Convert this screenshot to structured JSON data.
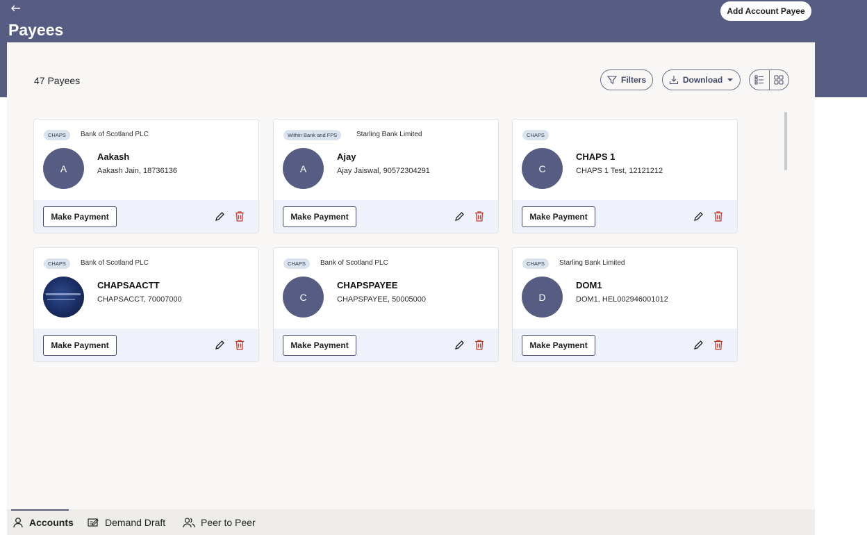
{
  "header": {
    "back_icon": "arrow-left-icon",
    "title": "Payees",
    "add_button_label": "Add Account Payee",
    "band_color": "#575d82"
  },
  "toolbar": {
    "count_label": "47 Payees",
    "filters_label": "Filters",
    "download_label": "Download",
    "view_modes": [
      "list-view-icon",
      "grid-view-icon"
    ]
  },
  "payees": [
    {
      "tag": "CHAPS",
      "bank": "Bank of Scotland PLC",
      "initial": "A",
      "name": "Aakash",
      "detail": "Aakash Jain, 18736136",
      "action": "Make Payment"
    },
    {
      "tag": "Within Bank and FPS",
      "bank": "Starling Bank Limited",
      "initial": "A",
      "name": "Ajay",
      "detail": "Ajay Jaiswal, 90572304291",
      "action": "Make Payment"
    },
    {
      "tag": "CHAPS",
      "bank": "",
      "initial": "C",
      "name": "CHAPS 1",
      "detail": "CHAPS 1 Test, 12121212",
      "action": "Make Payment"
    },
    {
      "tag": "CHAPS",
      "bank": "Bank of Scotland PLC",
      "initial": "",
      "name": "CHAPSAACTT",
      "detail": "CHAPSACCT, 70007000",
      "action": "Make Payment"
    },
    {
      "tag": "CHAPS",
      "bank": "Bank of Scotland PLC",
      "initial": "C",
      "name": "CHAPSPAYEE",
      "detail": "CHAPSPAYEE, 50005000",
      "action": "Make Payment"
    },
    {
      "tag": "CHAPS",
      "bank": "Starling Bank Limited",
      "initial": "D",
      "name": "DOM1",
      "detail": "DOM1, HEL002946001012",
      "action": "Make Payment"
    }
  ],
  "tabs": [
    {
      "label": "Accounts",
      "icon": "person-icon",
      "active": true
    },
    {
      "label": "Demand Draft",
      "icon": "draft-icon",
      "active": false
    },
    {
      "label": "Peer to Peer",
      "icon": "people-icon",
      "active": false
    }
  ],
  "colors": {
    "accent": "#575d82",
    "delete": "#c0392b",
    "footer_bg": "#eff1fb",
    "tag_bg": "#d8e3ee"
  }
}
